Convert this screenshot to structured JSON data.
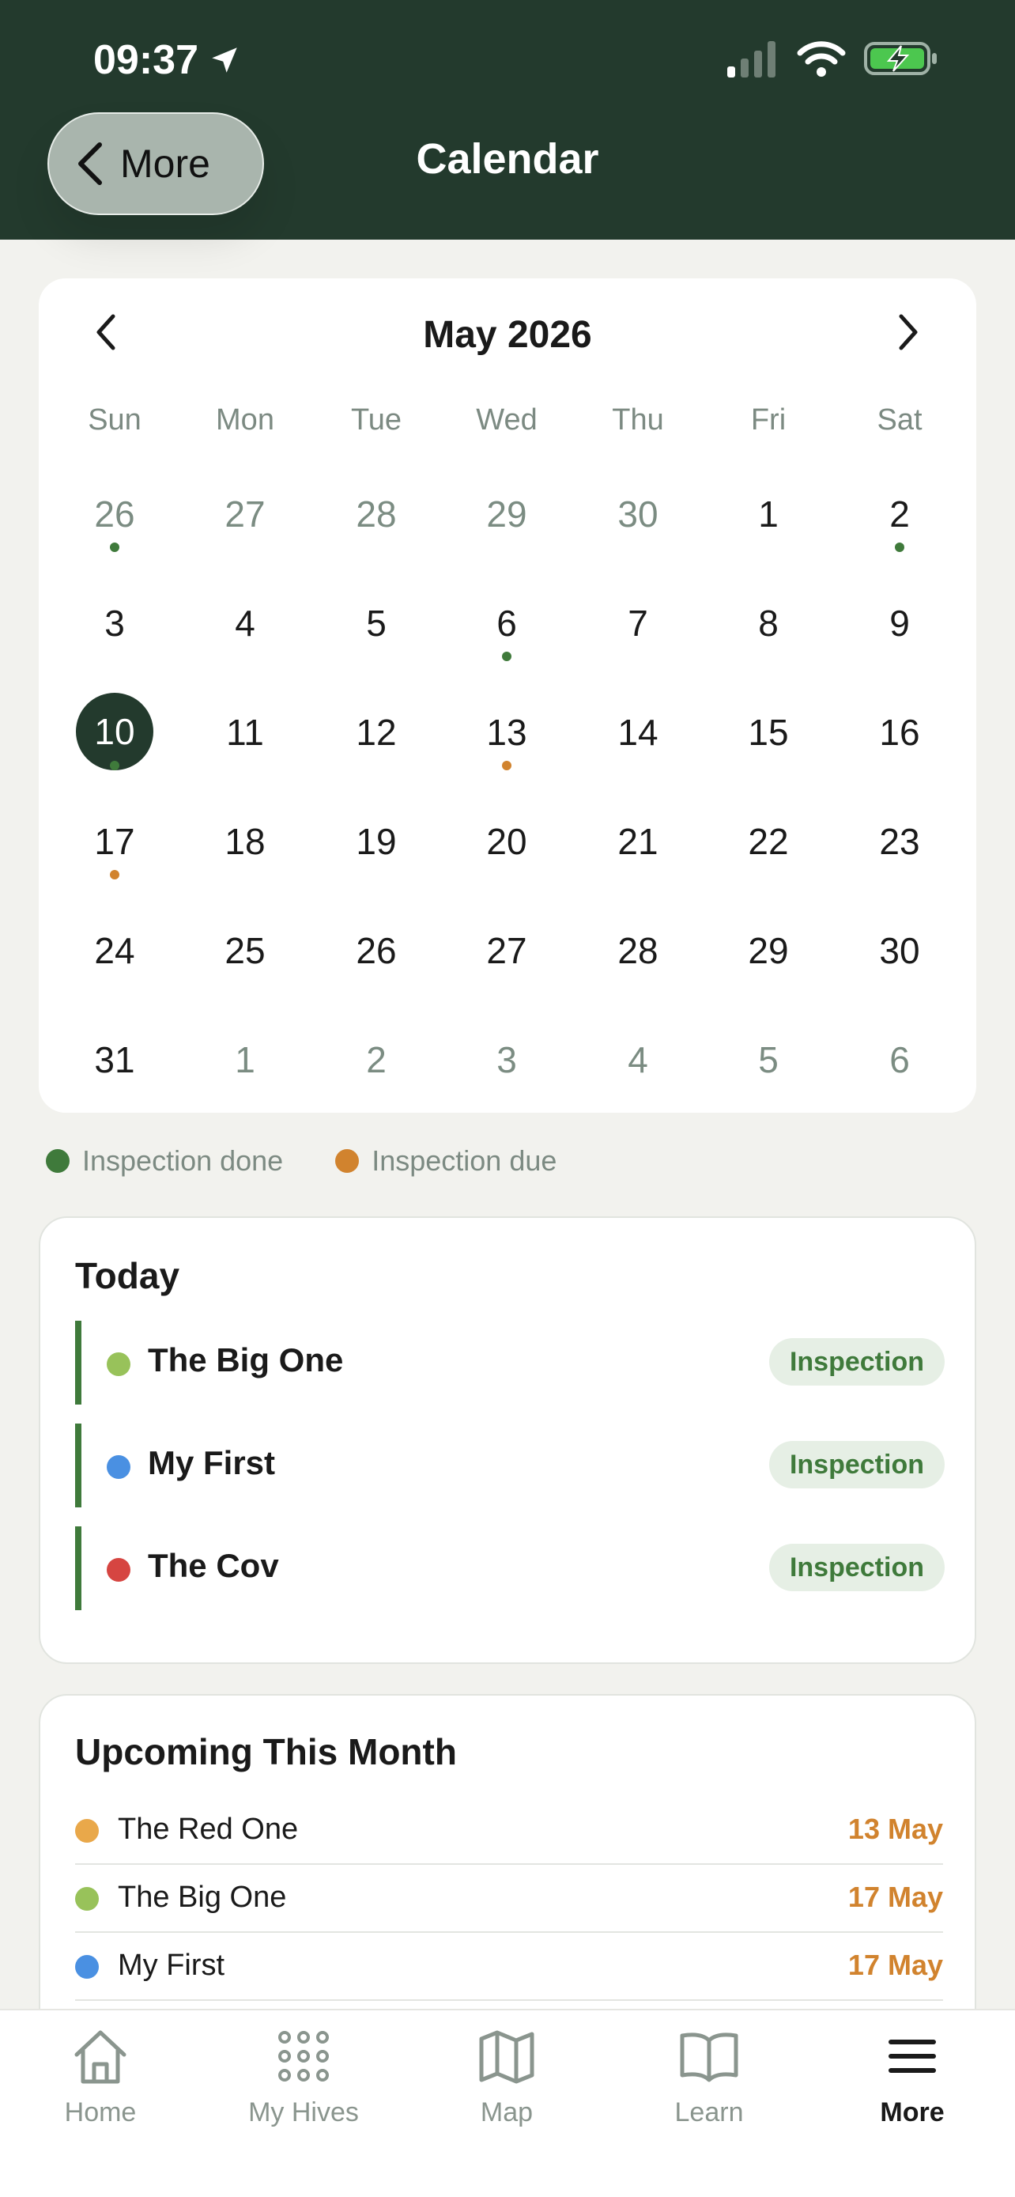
{
  "status_bar": {
    "time": "09:37"
  },
  "header": {
    "back_label": "More",
    "title": "Calendar"
  },
  "calendar": {
    "month_title": "May 2026",
    "weekdays": [
      "Sun",
      "Mon",
      "Tue",
      "Wed",
      "Thu",
      "Fri",
      "Sat"
    ],
    "weeks": [
      [
        {
          "d": "26",
          "muted": true,
          "dot": "done"
        },
        {
          "d": "27",
          "muted": true
        },
        {
          "d": "28",
          "muted": true
        },
        {
          "d": "29",
          "muted": true
        },
        {
          "d": "30",
          "muted": true
        },
        {
          "d": "1"
        },
        {
          "d": "2",
          "dot": "done"
        }
      ],
      [
        {
          "d": "3"
        },
        {
          "d": "4"
        },
        {
          "d": "5"
        },
        {
          "d": "6",
          "dot": "done"
        },
        {
          "d": "7"
        },
        {
          "d": "8"
        },
        {
          "d": "9"
        }
      ],
      [
        {
          "d": "10",
          "selected": true,
          "dot": "done"
        },
        {
          "d": "11"
        },
        {
          "d": "12"
        },
        {
          "d": "13",
          "dot": "due"
        },
        {
          "d": "14"
        },
        {
          "d": "15"
        },
        {
          "d": "16"
        }
      ],
      [
        {
          "d": "17",
          "dot": "due"
        },
        {
          "d": "18"
        },
        {
          "d": "19"
        },
        {
          "d": "20"
        },
        {
          "d": "21"
        },
        {
          "d": "22"
        },
        {
          "d": "23"
        }
      ],
      [
        {
          "d": "24"
        },
        {
          "d": "25"
        },
        {
          "d": "26"
        },
        {
          "d": "27"
        },
        {
          "d": "28"
        },
        {
          "d": "29"
        },
        {
          "d": "30"
        }
      ],
      [
        {
          "d": "31"
        },
        {
          "d": "1",
          "muted": true
        },
        {
          "d": "2",
          "muted": true
        },
        {
          "d": "3",
          "muted": true
        },
        {
          "d": "4",
          "muted": true
        },
        {
          "d": "5",
          "muted": true
        },
        {
          "d": "6",
          "muted": true
        }
      ]
    ]
  },
  "legend": {
    "done_label": "Inspection done",
    "due_label": "Inspection due"
  },
  "colors": {
    "header_bg": "#233a2d",
    "done": "#3f7a3b",
    "due": "#d1832e",
    "selected_day_bg": "#233a2d",
    "pill_bg": "#e6efe5"
  },
  "today": {
    "title": "Today",
    "items": [
      {
        "name": "The Big One",
        "color": "#98c25a",
        "tag": "Inspection"
      },
      {
        "name": "My First",
        "color": "#4a90e2",
        "tag": "Inspection"
      },
      {
        "name": "The Cov",
        "color": "#d64541",
        "tag": "Inspection"
      }
    ]
  },
  "upcoming": {
    "title": "Upcoming This Month",
    "items": [
      {
        "name": "The Red One",
        "color": "#e9a84a",
        "date": "13 May"
      },
      {
        "name": "The Big One",
        "color": "#98c25a",
        "date": "17 May"
      },
      {
        "name": "My First",
        "color": "#4a90e2",
        "date": "17 May"
      }
    ]
  },
  "tabbar": {
    "tabs": [
      {
        "label": "Home",
        "icon": "home-icon"
      },
      {
        "label": "My Hives",
        "icon": "grid-dots-icon"
      },
      {
        "label": "Map",
        "icon": "map-icon"
      },
      {
        "label": "Learn",
        "icon": "book-icon"
      },
      {
        "label": "More",
        "icon": "menu-icon",
        "active": true
      }
    ]
  }
}
